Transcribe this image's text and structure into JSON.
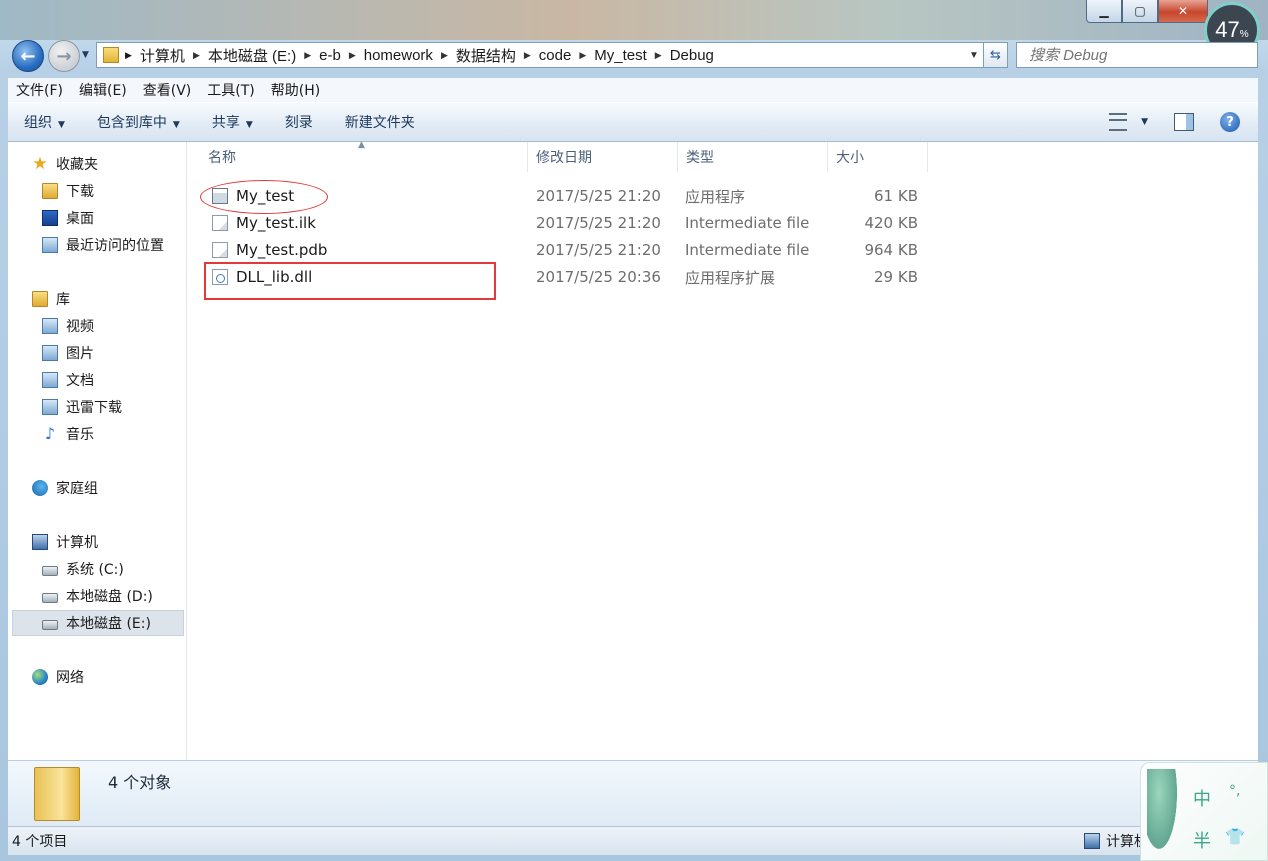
{
  "title_buttons": {
    "minimize": "▁",
    "maximize": "▢",
    "close": "✕"
  },
  "gauge": {
    "value": "47",
    "unit": "%"
  },
  "nav": {
    "breadcrumbs": [
      "计算机",
      "本地磁盘 (E:)",
      "e-b",
      "homework",
      "数据结构",
      "code",
      "My_test",
      "Debug"
    ],
    "search_placeholder": "搜索 Debug"
  },
  "menu": [
    "文件(F)",
    "编辑(E)",
    "查看(V)",
    "工具(T)",
    "帮助(H)"
  ],
  "toolbar": {
    "organize": "组织",
    "include_library": "包含到库中",
    "share": "共享",
    "burn": "刻录",
    "new_folder": "新建文件夹"
  },
  "sidebar": {
    "favorites": "收藏夹",
    "downloads": "下载",
    "desktop": "桌面",
    "recent": "最近访问的位置",
    "libraries": "库",
    "videos": "视频",
    "pictures": "图片",
    "documents": "文档",
    "xunlei": "迅雷下载",
    "music": "音乐",
    "homegroup": "家庭组",
    "computer": "计算机",
    "drive_c": "系统 (C:)",
    "drive_d": "本地磁盘 (D:)",
    "drive_e": "本地磁盘 (E:)",
    "network": "网络"
  },
  "columns": {
    "name": "名称",
    "modified": "修改日期",
    "type": "类型",
    "size": "大小"
  },
  "files": [
    {
      "name": "My_test",
      "modified": "2017/5/25 21:20",
      "type": "应用程序",
      "size": "61 KB"
    },
    {
      "name": "My_test.ilk",
      "modified": "2017/5/25 21:20",
      "type": "Intermediate file",
      "size": "420 KB"
    },
    {
      "name": "My_test.pdb",
      "modified": "2017/5/25 21:20",
      "type": "Intermediate file",
      "size": "964 KB"
    },
    {
      "name": "DLL_lib.dll",
      "modified": "2017/5/25 20:36",
      "type": "应用程序扩展",
      "size": "29 KB"
    }
  ],
  "details": {
    "count_text": "4 个对象"
  },
  "status": {
    "left": "4 个项目",
    "right": "计算机"
  },
  "ime": {
    "k1": "中",
    "k2": "°,",
    "k3": "半",
    "k4": "👕"
  },
  "colors": {
    "annotation": "#e03a3a",
    "accent": "#1e395b"
  }
}
